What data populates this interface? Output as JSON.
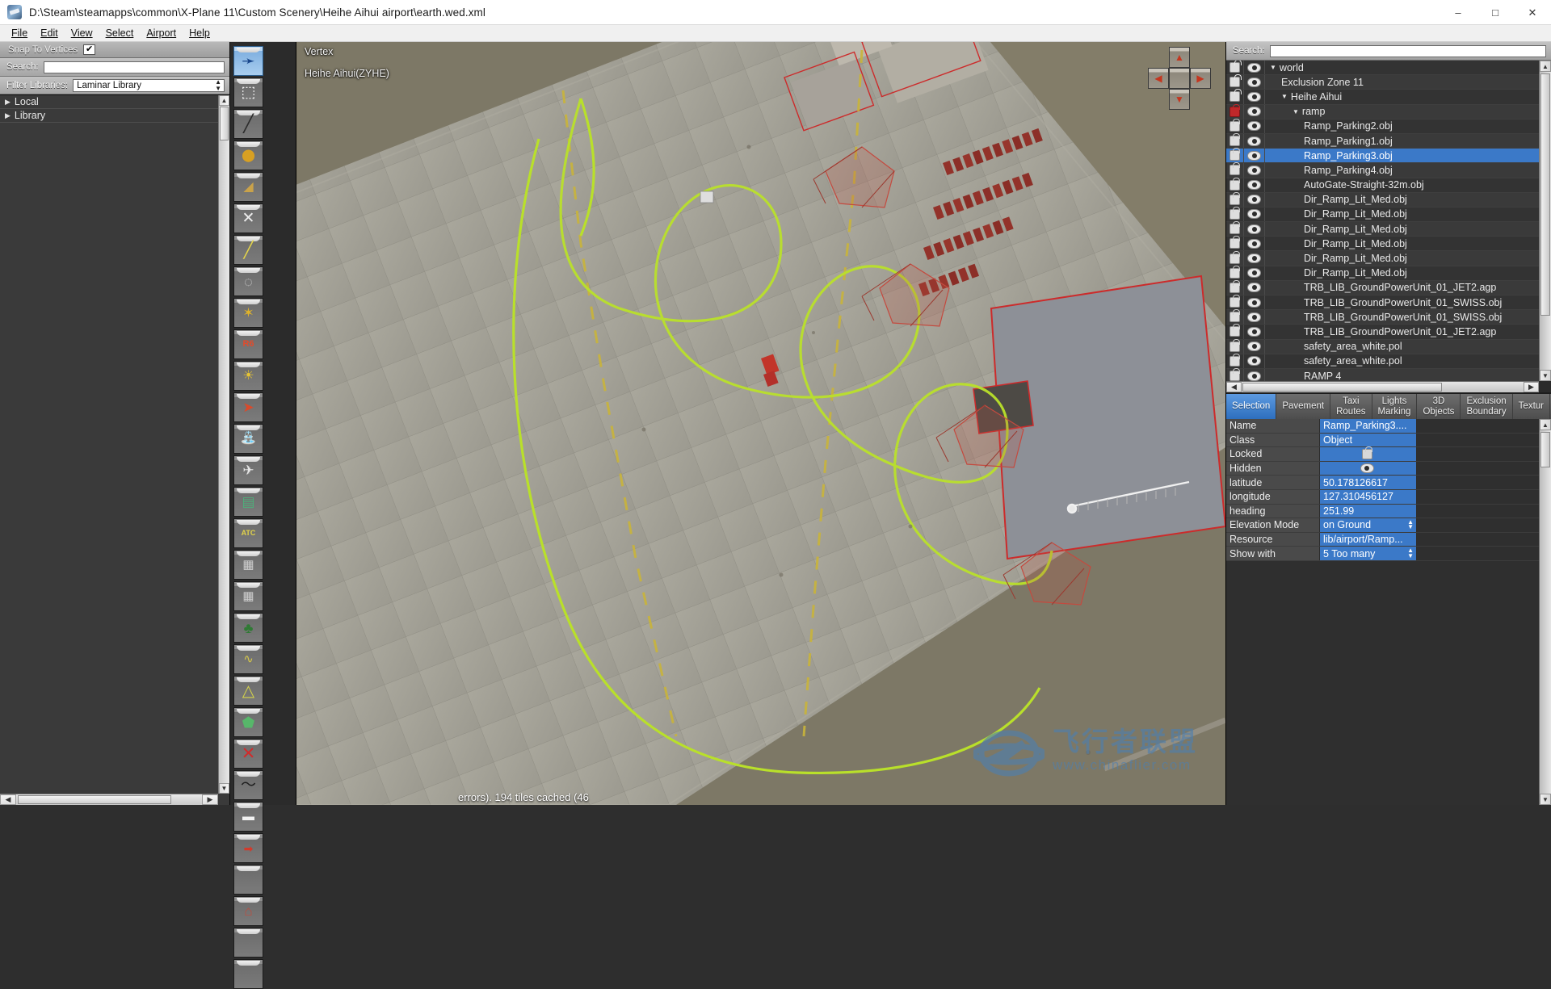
{
  "window": {
    "title": "D:\\Steam\\steamapps\\common\\X-Plane 11\\Custom Scenery\\Heihe Aihui airport\\earth.wed.xml",
    "app_icon": "wed-app-icon",
    "minimize": "–",
    "maximize": "□",
    "close": "✕"
  },
  "menu": {
    "items": [
      {
        "label": "File",
        "accel": "F"
      },
      {
        "label": "Edit",
        "accel": "E"
      },
      {
        "label": "View",
        "accel": "V"
      },
      {
        "label": "Select",
        "accel": "S"
      },
      {
        "label": "Airport",
        "accel": "A"
      },
      {
        "label": "Help",
        "accel": "H"
      }
    ]
  },
  "library_panel": {
    "snap_label": "Snap To Vertices",
    "snap_checked": true,
    "snap_check_glyph": "✔",
    "search_label": "Search:",
    "search_value": "",
    "search_placeholder": "",
    "filter_label": "Filter Libraries:",
    "filter_value": "Laminar Library",
    "nodes": [
      {
        "label": "Local",
        "expander": "▶"
      },
      {
        "label": "Library",
        "expander": "▶"
      }
    ]
  },
  "tool_palette": {
    "tools": [
      {
        "name": "arrow-select-tool",
        "glyph": "↖",
        "selected": true
      },
      {
        "name": "marquee-select-tool",
        "glyph": "⬚",
        "selected": false
      },
      {
        "name": "runway-tool",
        "glyph": "╱",
        "selected": false
      },
      {
        "name": "helipad-tool",
        "glyph": "⬤",
        "selected": false
      },
      {
        "name": "sealane-tool",
        "glyph": "◢",
        "selected": false
      },
      {
        "name": "taxiway-tool",
        "glyph": "✕",
        "selected": false
      },
      {
        "name": "taxiline-tool",
        "glyph": "∣",
        "selected": false
      },
      {
        "name": "hole-tool",
        "glyph": "◌",
        "selected": false
      },
      {
        "name": "beacon-tool",
        "glyph": "✶",
        "selected": false
      },
      {
        "name": "sign-tool",
        "glyph": "R6",
        "selected": false
      },
      {
        "name": "light-fixture-tool",
        "glyph": "☀",
        "selected": false
      },
      {
        "name": "windsock-tool",
        "glyph": "➤",
        "selected": false
      },
      {
        "name": "tower-viewpoint-tool",
        "glyph": "☖",
        "selected": false
      },
      {
        "name": "ramp-start-tool",
        "glyph": "✈",
        "selected": false
      },
      {
        "name": "facade-tool",
        "glyph": "▤",
        "selected": false
      },
      {
        "name": "atc-flow-tool",
        "glyph": "ATC",
        "selected": false
      },
      {
        "name": "autogen-block-tool",
        "glyph": "▦",
        "selected": false
      },
      {
        "name": "autogen-string-tool",
        "glyph": "∵",
        "selected": false
      },
      {
        "name": "forest-tool",
        "glyph": "ἳ2",
        "selected": false
      },
      {
        "name": "string-tool",
        "glyph": "∿",
        "selected": false
      },
      {
        "name": "line-tool",
        "glyph": "∧",
        "selected": false
      },
      {
        "name": "polygon-tool",
        "glyph": "⬟",
        "selected": false
      },
      {
        "name": "exclusion-tool",
        "glyph": "✕",
        "selected": false
      },
      {
        "name": "draped-line-tool",
        "glyph": "〜",
        "selected": false
      },
      {
        "name": "taxi-route-tool",
        "glyph": "━",
        "selected": false
      },
      {
        "name": "truck-route-tool",
        "glyph": "➡",
        "selected": false
      },
      {
        "name": "empty-tool-a",
        "glyph": "",
        "selected": false
      },
      {
        "name": "building-tool",
        "glyph": "⌂",
        "selected": false
      },
      {
        "name": "empty-tool-b",
        "glyph": "",
        "selected": false
      },
      {
        "name": "empty-tool-c",
        "glyph": "",
        "selected": false
      }
    ]
  },
  "map": {
    "mode_label": "Vertex",
    "airport_label": "Heihe Aihui(ZYHE)",
    "status": "errors). 194 tiles cached (46",
    "nav_up": "▲",
    "nav_down": "▼",
    "nav_left": "◀",
    "nav_right": "▶",
    "watermark_cn": "飞行者联盟",
    "watermark_url": "www.chinaflier.com"
  },
  "outliner": {
    "search_label": "Search:",
    "search_value": "",
    "rows": [
      {
        "label": "world",
        "indent": 0,
        "tri": "▼",
        "lock": "open",
        "selected": false
      },
      {
        "label": "Exclusion Zone 11",
        "indent": 1,
        "tri": "",
        "lock": "open",
        "selected": false
      },
      {
        "label": "Heihe Aihui",
        "indent": 1,
        "tri": "▼",
        "lock": "open",
        "selected": false
      },
      {
        "label": "ramp",
        "indent": 2,
        "tri": "▼",
        "lock": "red",
        "selected": false
      },
      {
        "label": "Ramp_Parking2.obj",
        "indent": 3,
        "tri": "",
        "lock": "closed",
        "selected": false
      },
      {
        "label": "Ramp_Parking1.obj",
        "indent": 3,
        "tri": "",
        "lock": "closed",
        "selected": false
      },
      {
        "label": "Ramp_Parking3.obj",
        "indent": 3,
        "tri": "",
        "lock": "closed",
        "selected": true
      },
      {
        "label": "Ramp_Parking4.obj",
        "indent": 3,
        "tri": "",
        "lock": "closed",
        "selected": false
      },
      {
        "label": "AutoGate-Straight-32m.obj",
        "indent": 3,
        "tri": "",
        "lock": "closed",
        "selected": false
      },
      {
        "label": "Dir_Ramp_Lit_Med.obj",
        "indent": 3,
        "tri": "",
        "lock": "closed",
        "selected": false
      },
      {
        "label": "Dir_Ramp_Lit_Med.obj",
        "indent": 3,
        "tri": "",
        "lock": "closed",
        "selected": false
      },
      {
        "label": "Dir_Ramp_Lit_Med.obj",
        "indent": 3,
        "tri": "",
        "lock": "closed",
        "selected": false
      },
      {
        "label": "Dir_Ramp_Lit_Med.obj",
        "indent": 3,
        "tri": "",
        "lock": "closed",
        "selected": false
      },
      {
        "label": "Dir_Ramp_Lit_Med.obj",
        "indent": 3,
        "tri": "",
        "lock": "closed",
        "selected": false
      },
      {
        "label": "Dir_Ramp_Lit_Med.obj",
        "indent": 3,
        "tri": "",
        "lock": "closed",
        "selected": false
      },
      {
        "label": "TRB_LIB_GroundPowerUnit_01_JET2.agp",
        "indent": 3,
        "tri": "",
        "lock": "closed",
        "selected": false
      },
      {
        "label": "TRB_LIB_GroundPowerUnit_01_SWISS.obj",
        "indent": 3,
        "tri": "",
        "lock": "closed",
        "selected": false
      },
      {
        "label": "TRB_LIB_GroundPowerUnit_01_SWISS.obj",
        "indent": 3,
        "tri": "",
        "lock": "closed",
        "selected": false
      },
      {
        "label": "TRB_LIB_GroundPowerUnit_01_JET2.agp",
        "indent": 3,
        "tri": "",
        "lock": "closed",
        "selected": false
      },
      {
        "label": "safety_area_white.pol",
        "indent": 3,
        "tri": "",
        "lock": "closed",
        "selected": false
      },
      {
        "label": "safety_area_white.pol",
        "indent": 3,
        "tri": "",
        "lock": "closed",
        "selected": false
      },
      {
        "label": "RAMP 4",
        "indent": 3,
        "tri": "",
        "lock": "closed",
        "selected": false
      }
    ]
  },
  "property_tabs": {
    "tabs": [
      {
        "line1": "",
        "line2": "Selection",
        "active": true
      },
      {
        "line1": "",
        "line2": "Pavement",
        "active": false
      },
      {
        "line1": "Taxi",
        "line2": "Routes",
        "active": false
      },
      {
        "line1": "Lights",
        "line2": "Marking",
        "active": false
      },
      {
        "line1": "3D",
        "line2": "Objects",
        "active": false
      },
      {
        "line1": "Exclusion",
        "line2": "Boundary",
        "active": false
      },
      {
        "line1": "",
        "line2": "Textur",
        "active": false
      }
    ]
  },
  "properties": {
    "rows": [
      {
        "key": "Name",
        "value": "Ramp_Parking3....",
        "kind": "text"
      },
      {
        "key": "Class",
        "value": "Object",
        "kind": "text"
      },
      {
        "key": "Locked",
        "value": "",
        "kind": "lock"
      },
      {
        "key": "Hidden",
        "value": "",
        "kind": "eye"
      },
      {
        "key": "latitude",
        "value": "50.178126617",
        "kind": "text"
      },
      {
        "key": "longitude",
        "value": "127.310456127",
        "kind": "text"
      },
      {
        "key": "heading",
        "value": "251.99",
        "kind": "text"
      },
      {
        "key": "Elevation Mode",
        "value": "on Ground",
        "kind": "select"
      },
      {
        "key": "Resource",
        "value": "lib/airport/Ramp...",
        "kind": "text"
      },
      {
        "key": "Show with",
        "value": "5 Too many",
        "kind": "select"
      }
    ]
  },
  "colors": {
    "selection_blue": "#3b79c8",
    "tab_active": "#2d6fbe",
    "lock_red": "#c0282a",
    "taxiway_green": "#b9e02a",
    "taxiway_yellow": "#d9c23a",
    "boundary_red": "#cc2b2b",
    "watermark_blue": "#4e7fb0"
  }
}
